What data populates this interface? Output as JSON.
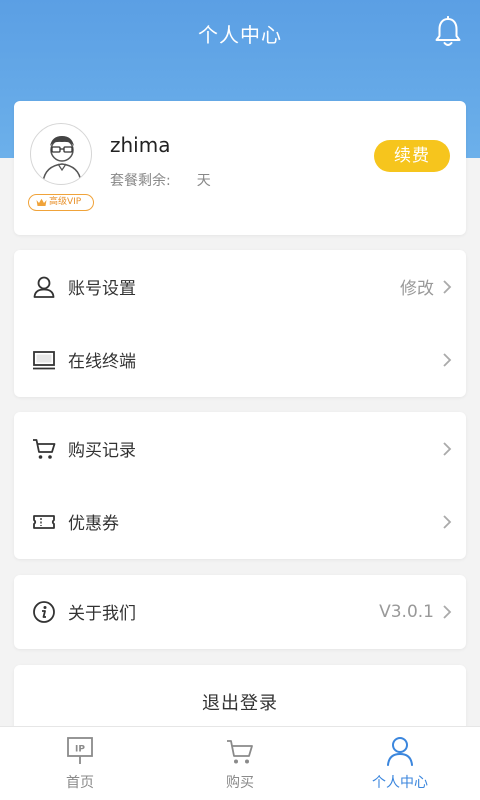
{
  "header": {
    "title": "个人中心",
    "bell_icon": "bell-icon"
  },
  "profile": {
    "username": "zhima",
    "remain_label": "套餐剩余:",
    "remain_value": "",
    "remain_unit": "天",
    "vip_label": "高级VIP",
    "renew_label": "续费",
    "avatar_icon": "avatar-icon",
    "crown_icon": "crown-icon"
  },
  "menu": {
    "account": {
      "label": "账号设置",
      "value": "修改",
      "icon": "user-icon"
    },
    "terminal": {
      "label": "在线终端",
      "icon": "monitor-icon"
    },
    "purchases": {
      "label": "购买记录",
      "icon": "cart-icon"
    },
    "coupons": {
      "label": "优惠券",
      "icon": "ticket-icon"
    },
    "about": {
      "label": "关于我们",
      "value": "V3.0.1",
      "icon": "info-icon"
    }
  },
  "logout_label": "退出登录",
  "tabs": [
    {
      "label": "首页",
      "icon": "ip-icon",
      "active": false
    },
    {
      "label": "购买",
      "icon": "cart-icon",
      "active": false
    },
    {
      "label": "个人中心",
      "icon": "person-icon",
      "active": true
    }
  ],
  "colors": {
    "header_blue": "#5b9fe4",
    "renew_yellow": "#f6c51d",
    "vip_orange": "#f0a33a",
    "active_tab": "#3b86dd"
  }
}
